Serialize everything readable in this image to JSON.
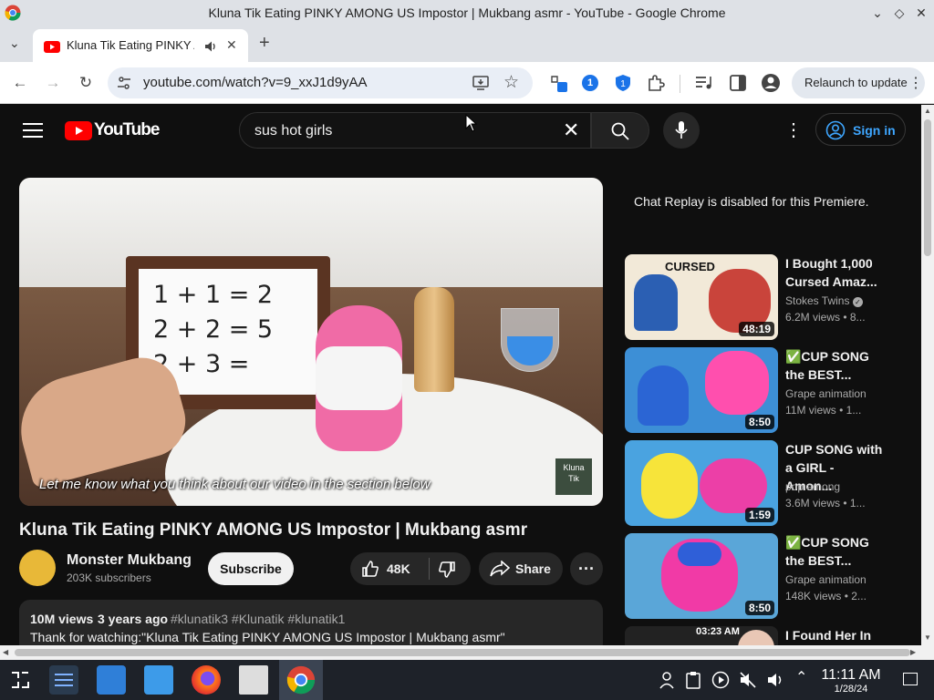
{
  "window": {
    "title": "Kluna Tik Eating PINKY AMONG US Impostor | Mukbang asmr - YouTube - Google Chrome"
  },
  "tab": {
    "label": "Kluna Tik Eating PINKY A"
  },
  "address": {
    "url": "youtube.com/watch?v=9_xxJ1d9yAA",
    "relaunch_label": "Relaunch to update",
    "extension_badge": "1"
  },
  "youtube": {
    "logo_text": "YouTube",
    "search_query": "sus hot girls",
    "sign_in_label": "Sign in",
    "player": {
      "caption": "Let me know what you think about our video in the section below",
      "whiteboard_lines": [
        "1 + 1 = 2",
        "2 + 2 = 5",
        "2 + 3 ="
      ],
      "watermark_lines": [
        "Kluna",
        "Tik"
      ]
    },
    "video_title": "Kluna Tik Eating PINKY AMONG US Impostor | Mukbang asmr",
    "channel": {
      "name": "Monster Mukbang",
      "subscribers": "203K subscribers",
      "subscribe_label": "Subscribe"
    },
    "actions": {
      "likes": "48K",
      "share_label": "Share"
    },
    "description": {
      "views": "10M views",
      "age": "3 years ago",
      "hashtags": "#klunatik3 #Klunatik #klunatik1",
      "text": "Thank for watching:\"Kluna Tik Eating PINKY AMONG US Impostor | Mukbang asmr\""
    },
    "chat_note": "Chat Replay is disabled for this Premiere.",
    "recommendations": [
      {
        "title": "I Bought 1,000 Cursed Amaz...",
        "channel": "Stokes Twins",
        "verified": true,
        "meta": "6.2M views • 8...",
        "duration": "48:19",
        "thumb_text": "CURSED",
        "thumb_color": "#f2e9d8"
      },
      {
        "title": "✅CUP SONG the BEST...",
        "channel": "Grape animation",
        "verified": false,
        "meta": "11M views • 1...",
        "duration": "8:50",
        "thumb_text": "",
        "thumb_color": "#3d8fd6"
      },
      {
        "title": "CUP SONG with a GIRL - Amon...",
        "channel": "pop among",
        "verified": false,
        "meta": "3.6M views • 1...",
        "duration": "1:59",
        "thumb_text": "",
        "thumb_color": "#4aa3e0"
      },
      {
        "title": "✅CUP SONG the BEST...",
        "channel": "Grape animation",
        "verified": false,
        "meta": "148K views • 2...",
        "duration": "8:50",
        "thumb_text": "",
        "thumb_color": "#5aa6d8"
      },
      {
        "title": "I Found Her In",
        "channel": "",
        "verified": false,
        "meta": "",
        "duration": "03:23 AM",
        "thumb_text": "",
        "thumb_color": "#222"
      }
    ]
  },
  "taskbar": {
    "time": "11:11 AM",
    "date": "1/28/24"
  }
}
